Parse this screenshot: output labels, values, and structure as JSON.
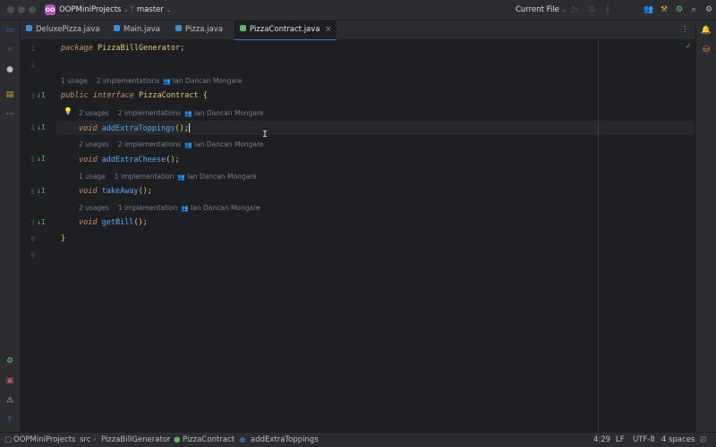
{
  "titlebar": {
    "project": "OOPMiniProjects",
    "project_badge": "OO",
    "branch": "master",
    "run_config": "Current File",
    "icons": [
      "people-icon",
      "hammer-icon",
      "settings-gear-icon",
      "search-icon",
      "gear-icon"
    ]
  },
  "tabs": [
    {
      "label": "DeluxePizza.java",
      "active": false
    },
    {
      "label": "Main.java",
      "active": false
    },
    {
      "label": "Pizza.java",
      "active": false
    },
    {
      "label": "PizzaContract.java",
      "active": true
    }
  ],
  "editor": {
    "lines": [
      "1",
      "2",
      "3",
      "4",
      "5",
      "6",
      "7",
      "8",
      "9"
    ],
    "package_kw": "package",
    "package_name": "PizzaBillGenerator;",
    "public_kw": "public",
    "interface_kw": "interface",
    "interface_name": "PizzaContract",
    "open_brace": "{",
    "close_brace": "}",
    "void_kw": "void",
    "methods": [
      "addExtraToppings",
      "addExtraCheese",
      "takeAway",
      "getBill"
    ],
    "call_suffix": "();",
    "author": "Ian Dancan Mongare",
    "hints": [
      {
        "usages": "1 usage",
        "impls": "2 implementations"
      },
      {
        "usages": "2 usages",
        "impls": "2 implementations"
      },
      {
        "usages": "2 usages",
        "impls": "2 implementations"
      },
      {
        "usages": "1 usage",
        "impls": "1 implementation"
      },
      {
        "usages": "2 usages",
        "impls": "1 implementation"
      }
    ]
  },
  "statusbar": {
    "breadcrumb": [
      "OOPMiniProjects",
      "src",
      "PizzaBillGenerator",
      "PizzaContract",
      "addExtraToppings"
    ],
    "position": "4:29",
    "line_sep": "LF",
    "encoding": "UTF-8",
    "indent": "4 spaces"
  },
  "colors": {
    "accent": "#3574f0",
    "keyword": "#cf8e6d",
    "method": "#56a8f5",
    "interface": "#e8c76b",
    "badge": "#b74fbd"
  }
}
